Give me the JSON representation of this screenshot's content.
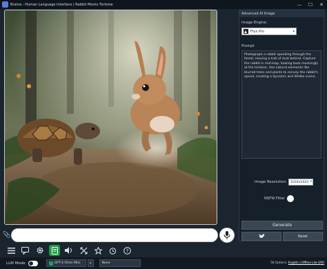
{
  "window": {
    "title": "Braina - Human Language Interface | Rabbit Mocks Tortoise",
    "minimize_glyph": "—",
    "maximize_glyph": "☐",
    "close_glyph": "✕"
  },
  "chat": {
    "input_value": "",
    "input_placeholder": ""
  },
  "toolbar": {
    "icons": [
      "menu-icon",
      "chat-history-icon",
      "gear-icon",
      "notes-icon",
      "speaker-icon",
      "expand-icon",
      "star-icon",
      "alarm-icon",
      "help-icon"
    ],
    "active_icon": "notes-icon",
    "active_color": "#1f9a45"
  },
  "statusbar": {
    "llm_mode_label": "LLM Mode",
    "model_value": "GPT-4 Omni Mini",
    "persona_value": "None",
    "options_prefix": "58 Options:",
    "options_link": "English | Offline Lite GPU"
  },
  "panel": {
    "title": "Advanced AI Image",
    "engine_label": "Image Engine:",
    "engine_value": "Flux Pro",
    "prompt_label": "Prompt",
    "prompt_text": "Photograph a rabbit speeding through the forest, leaving a trail of dust behind. Capture the rabbit in mid-leap, looking back mockingly at the tortoise. Use natural elements like blurred trees and plants to convey the rabbit's speed, creating a dynamic and lifelike scene.",
    "resolution_label": "Image Resolution:",
    "resolution_value": "1024x1024",
    "nsfw_label": "NSFW Filter",
    "generate_label": "Generate",
    "reset_label": "Reset"
  },
  "colors": {
    "background": "#1b2530",
    "panel": "#16202a",
    "accent_green": "#1f9a45"
  }
}
